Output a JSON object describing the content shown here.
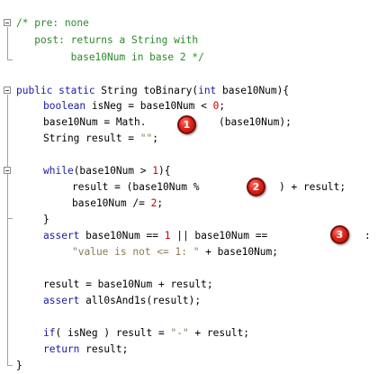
{
  "code": {
    "comment_line1": "/* pre: none",
    "comment_line2": "   post: returns a String with",
    "comment_line3": "         base10Num in base 2 */",
    "sig_kw": "public static",
    "sig_mid": " String toBinary(",
    "sig_int": "int",
    "sig_end": " base10Num){",
    "l_boolean_kw": "boolean",
    "l_boolean_mid": " isNeg = base10Num < ",
    "l_boolean_num": "0",
    "l_boolean_end": ";",
    "l_math_a": "base10Num = Math.",
    "l_math_b": "(base10Num);",
    "l_result_a": "String result = ",
    "l_result_str": "\"\"",
    "l_result_end": ";",
    "l_while_kw": "while",
    "l_while_mid": "(base10Num > ",
    "l_while_num": "1",
    "l_while_end": "){",
    "l_mod_a": "result = (base10Num %",
    "l_mod_b": ") + result;",
    "l_div_a": "base10Num /= ",
    "l_div_num": "2",
    "l_div_end": ";",
    "l_close1": "}",
    "l_assert1_kw": "assert",
    "l_assert1_a": " base10Num == ",
    "l_assert1_num": "1",
    "l_assert1_b": " || base10Num ==",
    "l_assert1_colon": ":",
    "l_assert1_str": "\"value is not <= 1: \"",
    "l_assert1_end": " + base10Num;",
    "l_concat": "result = base10Num + result;",
    "l_assert2_kw": "assert",
    "l_assert2_end": " all0sAnd1s(result);",
    "l_if_kw": "if",
    "l_if_mid": "( isNeg ) result = ",
    "l_if_str": "\"-\"",
    "l_if_end": " + result;",
    "l_return_kw": "return",
    "l_return_end": " result;",
    "l_close2": "}"
  },
  "badges": {
    "b1": "1",
    "b2": "2",
    "b3": "3"
  },
  "colors": {
    "comment": "#2c8a2c",
    "keyword": "#1a1aa6",
    "number": "#c80000",
    "string": "#8a7a55",
    "badge": "#e0261a"
  }
}
